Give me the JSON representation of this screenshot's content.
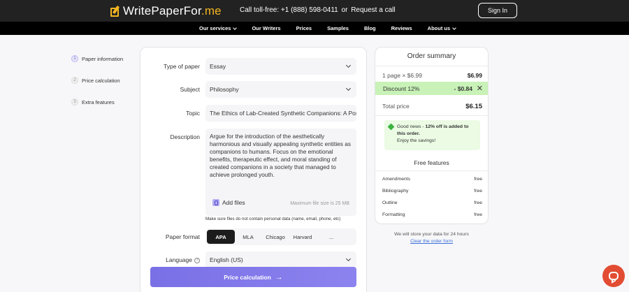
{
  "header": {
    "logo_main": "WritePaperFor",
    "logo_suffix": ".me",
    "call_label": "Call toll-free: +1 (888) 598-0411",
    "call_or": "or",
    "request_call": "Request a call",
    "sign_in": "Sign In"
  },
  "nav": {
    "items": [
      "Our services",
      "Our Writers",
      "Prices",
      "Samples",
      "Blog",
      "Reviews",
      "About us"
    ]
  },
  "steps": [
    {
      "num": "1",
      "label": "Paper information"
    },
    {
      "num": "2",
      "label": "Price calculation"
    },
    {
      "num": "3",
      "label": "Extra features"
    }
  ],
  "form": {
    "type_label": "Type of paper",
    "type_value": "Essay",
    "subject_label": "Subject",
    "subject_value": "Philosophy",
    "topic_label": "Topic",
    "topic_value": "The Ethics of Lab-Created Synthetic Companions: A Pos",
    "description_label": "Description",
    "description_value": "Argue for the introduction of the aesthetically harmonious and visually appealing synthetic entities as companions to humans. Focus on the emotional benefits, therapeutic effect, and moral standing of created companions in a society that managed to achieve prolonged youth.",
    "add_files": "Add files",
    "max_file_size": "Maximum file size is 25 MB",
    "files_note": "Make sure files do not contain personal data (name, email, phone, etc)",
    "format_label": "Paper format",
    "formats": [
      "APA",
      "MLA",
      "Chicago",
      "Harvard",
      "..."
    ],
    "selected_format": "APA",
    "language_label": "Language",
    "language_value": "English (US)",
    "info_glyph": "?",
    "price_button": "Price calculation",
    "price_arrow": "→"
  },
  "summary": {
    "title": "Order summary",
    "line_label": "1 page × $6.99",
    "line_amount": "$6.99",
    "discount_label": "Discount 12%",
    "discount_amount": "- $0.84",
    "discount_close": "✕",
    "total_label": "Total price",
    "total_amount": "$6.15",
    "news_prefix": "Good news - ",
    "news_bold": "12% off is added to this order.",
    "news_suffix": "Enjoy the savings!",
    "free_title": "Free features",
    "features": [
      {
        "name": "Amendments",
        "value": "free"
      },
      {
        "name": "Bibliography",
        "value": "free"
      },
      {
        "name": "Outline",
        "value": "free"
      },
      {
        "name": "Formatting",
        "value": "free"
      }
    ],
    "store_note": "We will store your data for 24 hours",
    "clear_link": "Clear the order form"
  },
  "colors": {
    "accent": "#7a70e6",
    "brand_yellow": "#f4b521",
    "discount_bg": "#c8f2b7",
    "chat": "#e24c33"
  },
  "icons": [
    "logo-pen-icon",
    "chevron-down-icon",
    "clip-icon",
    "info-icon",
    "arrow-right-icon",
    "tag-icon",
    "close-icon",
    "chat-icon"
  ]
}
